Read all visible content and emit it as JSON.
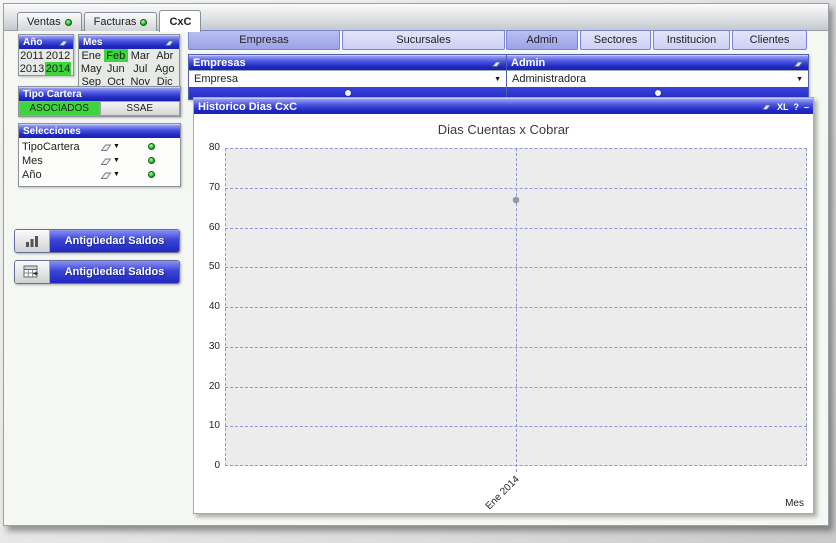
{
  "tabs": [
    {
      "label": "Ventas",
      "dot": true,
      "active": false
    },
    {
      "label": "Facturas",
      "dot": true,
      "active": false
    },
    {
      "label": "CxC",
      "dot": false,
      "active": true
    }
  ],
  "sidebar": {
    "year_box": {
      "title": "Año",
      "rows": [
        [
          "2011",
          "2012"
        ],
        [
          "2013",
          "2014"
        ]
      ],
      "selected": "2014"
    },
    "month_box": {
      "title": "Mes",
      "rows": [
        [
          "Ene",
          "Feb",
          "Mar",
          "Abr"
        ],
        [
          "May",
          "Jun",
          "Jul",
          "Ago"
        ],
        [
          "Sep",
          "Oct",
          "Nov",
          "Dic"
        ]
      ],
      "selected": "Feb"
    },
    "tipo_cartera": {
      "title": "Tipo Cartera",
      "options": [
        {
          "label": "ASOCIADOS",
          "selected": true
        },
        {
          "label": "SSAE",
          "selected": false
        }
      ]
    },
    "selections": {
      "title": "Selecciones",
      "rows": [
        {
          "field": "TipoCartera",
          "status": "green"
        },
        {
          "field": "Mes",
          "status": "green"
        },
        {
          "field": "Año",
          "status": "green"
        }
      ]
    },
    "buttons": [
      {
        "label": "Antigüedad Saldos",
        "icon": "bar-chart-icon"
      },
      {
        "label": "Antigüedad Saldos",
        "icon": "table-icon"
      }
    ]
  },
  "panels": {
    "left": {
      "nav": [
        {
          "label": "Empresas",
          "selected": true
        },
        {
          "label": "Sucursales",
          "selected": false
        }
      ],
      "listbox": {
        "title": "Empresas",
        "value": "Empresa"
      }
    },
    "right": {
      "nav": [
        {
          "label": "Admin",
          "selected": true
        },
        {
          "label": "Sectores",
          "selected": false
        },
        {
          "label": "Institucion",
          "selected": false
        },
        {
          "label": "Clientes",
          "selected": false
        }
      ],
      "listbox": {
        "title": "Admin",
        "value": "Administradora"
      }
    }
  },
  "chart_window": {
    "caption": "Historico Dias CxC",
    "icon_xl": "XL",
    "icon_help": "?",
    "icon_min": "–"
  },
  "chart_data": {
    "type": "line",
    "title": "Dias Cuentas x Cobrar",
    "categories": [
      "Ene 2014"
    ],
    "values": [
      67
    ],
    "ylim": [
      0,
      80
    ],
    "ytick": 10,
    "xlabel": "Mes",
    "grid": true,
    "legend": false,
    "plot_bg": "#ececec",
    "grid_color": "#9196d4",
    "point_color": "#8c9cb0"
  },
  "colors": {
    "caption_blue": "#2029c2",
    "selection_green": "#3ed43e",
    "nav_selected": "#9aa3e6",
    "nav_unselected": "#ccd1f4"
  }
}
